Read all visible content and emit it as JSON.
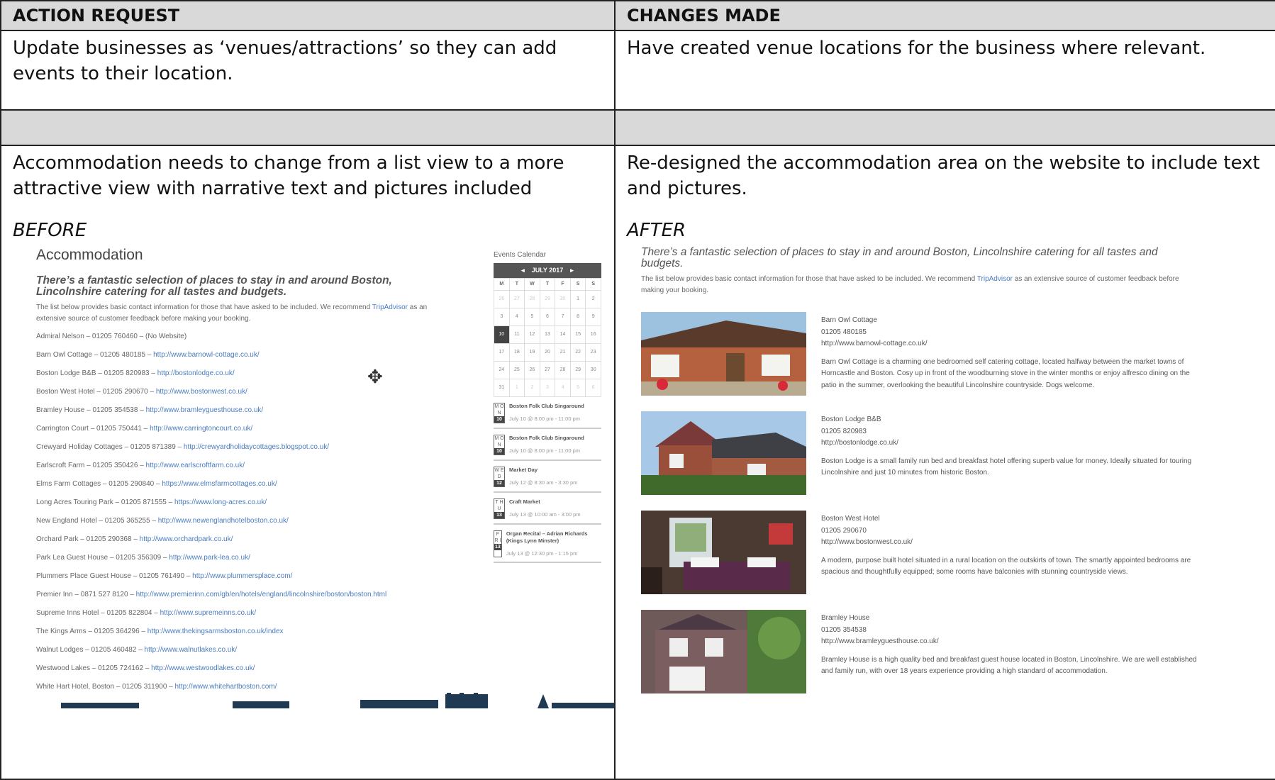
{
  "headers": {
    "left": "ACTION REQUEST",
    "right": "CHANGES MADE"
  },
  "row1": {
    "request": "Update businesses as ‘venues/attractions’ so they can add events to their location.",
    "change": "Have created venue locations for the business where relevant."
  },
  "row2": {
    "request": "Accommodation needs to change from a list view to a more attractive view with narrative text and pictures included",
    "change": "Re-designed the accommodation area on the website to include text and pictures.",
    "before_label": "BEFORE",
    "after_label": "AFTER"
  },
  "before": {
    "title": "Accommodation",
    "heading": "There’s a fantastic selection of places to stay in and around Boston, Lincolnshire catering for all tastes and budgets.",
    "intro_pre": "The list below provides basic contact information for those that have asked to be included. We recommend ",
    "intro_link": "TripAdvisor",
    "intro_post": " as an extensive source of customer feedback before making your booking.",
    "list": [
      {
        "text": "Admiral Nelson – 01205 760460 – (No Website)",
        "url": ""
      },
      {
        "text": "Barn Owl Cottage – 01205 480185 – ",
        "url": "http://www.barnowl-cottage.co.uk/"
      },
      {
        "text": "Boston Lodge B&B – 01205 820983 – ",
        "url": "http://bostonlodge.co.uk/"
      },
      {
        "text": "Boston West Hotel – 01205 290670 – ",
        "url": "http://www.bostonwest.co.uk/"
      },
      {
        "text": "Bramley House – 01205 354538 – ",
        "url": "http://www.bramleyguesthouse.co.uk/"
      },
      {
        "text": "Carrington Court – 01205 750441 – ",
        "url": "http://www.carringtoncourt.co.uk/"
      },
      {
        "text": "Crewyard Holiday Cottages – 01205 871389 – ",
        "url": "http://crewyardholidaycottages.blogspot.co.uk/"
      },
      {
        "text": "Earlscroft Farm – 01205 350426 – ",
        "url": "http://www.earlscroftfarm.co.uk/"
      },
      {
        "text": "Elms Farm Cottages – 01205 290840 – ",
        "url": "https://www.elmsfarmcottages.co.uk/"
      },
      {
        "text": "Long Acres Touring Park – 01205 871555 – ",
        "url": "https://www.long-acres.co.uk/"
      },
      {
        "text": "New England Hotel – 01205 365255 – ",
        "url": "http://www.newenglandhotelboston.co.uk/"
      },
      {
        "text": "Orchard Park – 01205 290368 – ",
        "url": "http://www.orchardpark.co.uk/"
      },
      {
        "text": "Park Lea Guest House – 01205 356309 – ",
        "url": "http://www.park-lea.co.uk/"
      },
      {
        "text": "Plummers Place Guest House – 01205 761490 – ",
        "url": "http://www.plummersplace.com/"
      },
      {
        "text": "Premier Inn – 0871 527 8120 – ",
        "url": "http://www.premierinn.com/gb/en/hotels/england/lincolnshire/boston/boston.html"
      },
      {
        "text": "Supreme Inns Hotel – 01205 822804 – ",
        "url": "http://www.supremeinns.co.uk/"
      },
      {
        "text": "The Kings Arms – 01205 364296 – ",
        "url": "http://www.thekingsarmsboston.co.uk/index"
      },
      {
        "text": "Walnut Lodges – 01205 460482 – ",
        "url": "http://www.walnutlakes.co.uk/"
      },
      {
        "text": "Westwood Lakes – 01205 724162 – ",
        "url": "http://www.westwoodlakes.co.uk/"
      },
      {
        "text": "White Hart Hotel, Boston – 01205 311900 – ",
        "url": "http://www.whitehartboston.com/"
      }
    ],
    "calendar": {
      "title": "Events Calendar",
      "month": "JULY 2017",
      "prev": "◂",
      "next": "▸",
      "day_names": [
        "M",
        "T",
        "W",
        "T",
        "F",
        "S",
        "S"
      ],
      "days": [
        "26",
        "27",
        "28",
        "29",
        "30",
        "1",
        "2",
        "3",
        "4",
        "5",
        "6",
        "7",
        "8",
        "9",
        "10",
        "11",
        "12",
        "13",
        "14",
        "15",
        "16",
        "17",
        "18",
        "19",
        "20",
        "21",
        "22",
        "23",
        "24",
        "25",
        "26",
        "27",
        "28",
        "29",
        "30",
        "31",
        "1",
        "2",
        "3",
        "4",
        "5",
        "6"
      ],
      "today": "10",
      "events": [
        {
          "day": "10",
          "dow": "M O N",
          "title": "Boston Folk Club Singaround",
          "time": "July 10 @ 8:00 pm - 11:00 pm"
        },
        {
          "day": "10",
          "dow": "M O N",
          "title": "Boston Folk Club Singaround",
          "time": "July 10 @ 8:00 pm - 11:00 pm"
        },
        {
          "day": "12",
          "dow": "W E D",
          "title": "Market Day",
          "time": "July 12 @ 8:30 am - 3:30 pm"
        },
        {
          "day": "13",
          "dow": "T H U",
          "title": "Craft Market",
          "time": "July 13 @ 10:00 am - 3:00 pm"
        },
        {
          "day": "13",
          "dow": "F R I",
          "title": "Organ Recital – Adrian Richards (Kings Lynn Minster)",
          "time": "July 13 @ 12:30 pm - 1:15 pm"
        }
      ]
    }
  },
  "after": {
    "heading": "There’s a fantastic selection of places to stay in and around Boston, Lincolnshire catering for all tastes and budgets.",
    "intro_pre": "The list below provides basic contact information for those that have asked to be included. We recommend ",
    "intro_link": "TripAdvisor",
    "intro_post": " as an extensive source of customer feedback before making your booking.",
    "items": [
      {
        "name": "Barn Owl Cottage",
        "phone": "01205 480185",
        "url": "http://www.barnowl-cottage.co.uk/",
        "desc": "Barn Owl Cottage is a charming one bedroomed self catering cottage, located halfway between the market towns of Horncastle and Boston. Cosy up in front of the woodburning stove in the winter months or enjoy alfresco dining on the patio in the summer, overlooking the beautiful Lincolnshire countryside. Dogs welcome."
      },
      {
        "name": "Boston Lodge B&B",
        "phone": "01205 820983",
        "url": "http://bostonlodge.co.uk/",
        "desc": "Boston Lodge is a small family run bed and breakfast hotel offering superb value for money. Ideally situated for touring Lincolnshire and just 10 minutes from historic Boston."
      },
      {
        "name": "Boston West Hotel",
        "phone": "01205 290670",
        "url": "http://www.bostonwest.co.uk/",
        "desc": "A modern, purpose built hotel situated in a rural location on the outskirts of town. The smartly appointed bedrooms are spacious and thoughtfully equipped; some rooms have balconies with stunning countryside views."
      },
      {
        "name": "Bramley House",
        "phone": "01205 354538",
        "url": "http://www.bramleyguesthouse.co.uk/",
        "desc": "Bramley House is a high quality bed and breakfast guest house located in Boston, Lincolnshire. We are well established and family run, with over 18 years experience providing a high standard of accommodation."
      }
    ]
  }
}
